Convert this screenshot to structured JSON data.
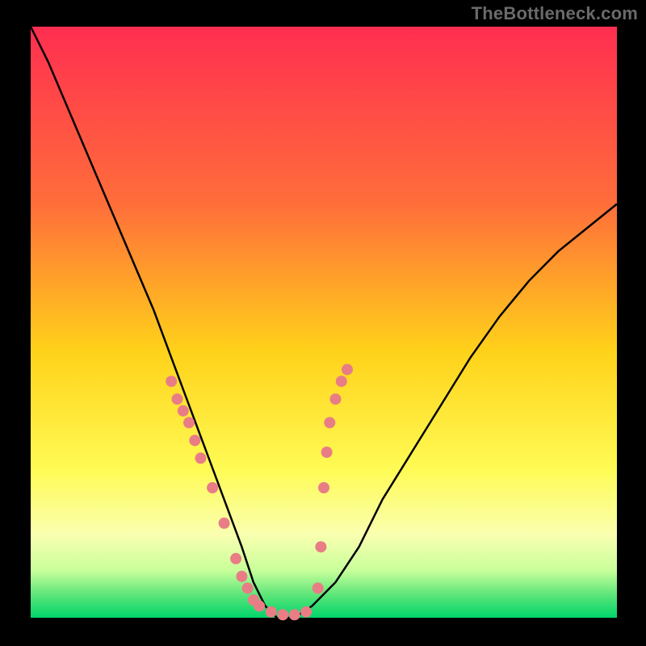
{
  "watermark": "TheBottleneck.com",
  "colors": {
    "black": "#000000",
    "curve": "#000000",
    "marker": "#e97d86",
    "grad_top": "#ff2e50",
    "grad_mid1": "#ff6e3a",
    "grad_mid2": "#ffd21a",
    "grad_mid3": "#fffb55",
    "grad_mid4": "#f9ffb0",
    "grad_low1": "#c8ff9a",
    "grad_low2": "#60e67a",
    "grad_bottom": "#00d56b"
  },
  "chart_data": {
    "type": "line",
    "title": "",
    "xlabel": "",
    "ylabel": "",
    "xlim": [
      0,
      100
    ],
    "ylim": [
      0,
      100
    ],
    "series": [
      {
        "name": "bottleneck-curve",
        "x": [
          0,
          3,
          6,
          9,
          12,
          15,
          18,
          21,
          24,
          27,
          30,
          33,
          36,
          38,
          40,
          42,
          45,
          48,
          52,
          56,
          60,
          65,
          70,
          75,
          80,
          85,
          90,
          95,
          100
        ],
        "y": [
          100,
          94,
          87,
          80,
          73,
          66,
          59,
          52,
          44,
          36,
          28,
          20,
          12,
          6,
          2,
          0,
          0,
          2,
          6,
          12,
          20,
          28,
          36,
          44,
          51,
          57,
          62,
          66,
          70
        ]
      }
    ],
    "markers": {
      "name": "sample-points",
      "x": [
        24,
        25,
        26,
        27,
        28,
        29,
        31,
        33,
        35,
        36,
        37,
        38,
        39,
        41,
        43,
        45,
        47,
        49,
        49.5,
        50,
        50.5,
        51,
        52,
        53,
        54
      ],
      "y": [
        40,
        37,
        35,
        33,
        30,
        27,
        22,
        16,
        10,
        7,
        5,
        3,
        2,
        1,
        0.5,
        0.5,
        1,
        5,
        12,
        22,
        28,
        33,
        37,
        40,
        42
      ]
    }
  }
}
